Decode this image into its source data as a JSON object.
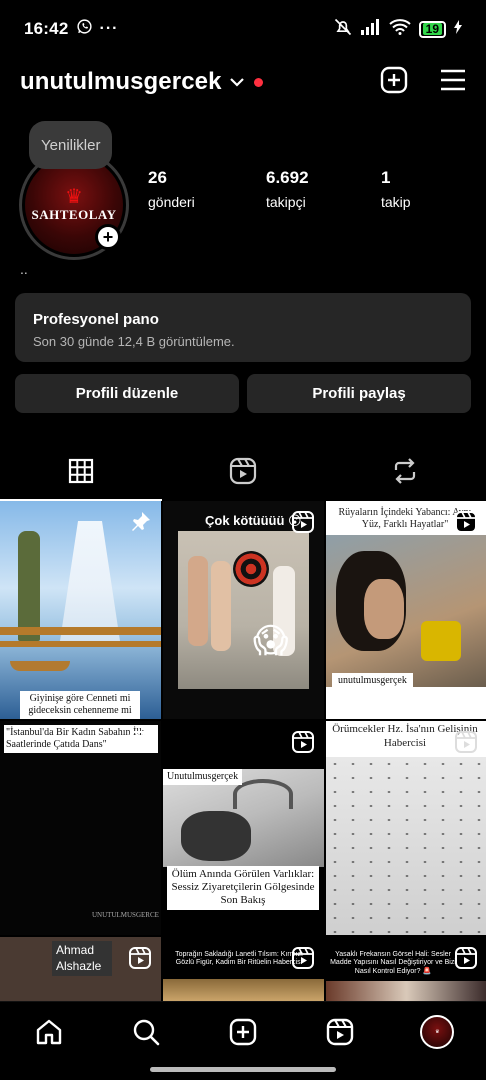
{
  "status": {
    "time": "16:42",
    "battery": "19"
  },
  "header": {
    "username": "unutulmusgercek"
  },
  "notes": {
    "label": "Yenilikler"
  },
  "avatar": {
    "brand": "SAHTEOLAY"
  },
  "stats": [
    {
      "num": "26",
      "label": "gönderi"
    },
    {
      "num": "6.692",
      "label": "takipçi"
    },
    {
      "num": "1",
      "label": "takip"
    }
  ],
  "bio": {
    "text": ".."
  },
  "pro_panel": {
    "title": "Profesyonel pano",
    "subtitle": "Son 30 günde 12,4 B görüntüleme."
  },
  "buttons": {
    "edit": "Profili düzenle",
    "share": "Profili paylaş"
  },
  "posts": [
    {
      "caption": "Giyinişe göre Cenneti mi gideceksin cehenneme mi",
      "pinned": true
    },
    {
      "caption": "Çok kötüüüü 😮",
      "reel": true
    },
    {
      "caption": "Rüyaların İçindeki Yabancı: Aynı Yüz, Farklı Hayatlar\"",
      "overlay": "unutulmusgerçek",
      "reel": true
    },
    {
      "caption": "\"İstanbul'da Bir Kadın Sabahın İlk Saatlerinde Çatıda Dans\"",
      "watermark": "UNUTULMUSGERCE",
      "reel": true
    },
    {
      "caption": "Ölüm Anında Görülen Varlıklar: Sessiz Ziyaretçilerin Gölgesinde Son Bakış",
      "overlay": "Unutulmusgerçek",
      "reel": true
    },
    {
      "caption": "Örümcekler Hz. İsa'nın Gelişinin Habercisi",
      "reel": true
    },
    {
      "caption": "Ahmad Alshazle",
      "reel": true
    },
    {
      "caption": "Toprağın Sakladığı Lanetli Tılsım: Kırmızı Gözlü Figür, Kadim Bir Ritüelin Habercisi",
      "reel": true
    },
    {
      "caption": "Yasaklı Frekansın Görsel Hali: Sesler Madde Yapısını Nasıl Değiştiriyor ve Bizi Nasıl Kontrol Ediyor? 🚨",
      "reel": true
    }
  ]
}
